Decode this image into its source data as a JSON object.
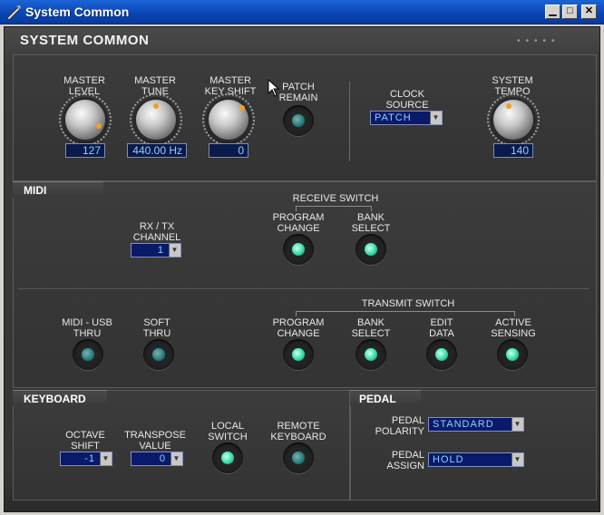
{
  "window": {
    "title": "System Common"
  },
  "header": {
    "title": "SYSTEM COMMON"
  },
  "system": {
    "master_level": {
      "label1": "MASTER",
      "label2": "LEVEL",
      "value": "127"
    },
    "master_tune": {
      "label1": "MASTER",
      "label2": "TUNE",
      "value": "440.00 Hz"
    },
    "master_key_shift": {
      "label1": "MASTER",
      "label2": "KEY SHIFT",
      "value": "0"
    },
    "patch_remain": {
      "label1": "PATCH",
      "label2": "REMAIN"
    },
    "clock_source": {
      "label1": "CLOCK",
      "label2": "SOURCE",
      "value": "PATCH"
    },
    "system_tempo": {
      "label1": "SYSTEM",
      "label2": "TEMPO",
      "value": "140"
    }
  },
  "midi": {
    "title": "MIDI",
    "rx_tx": {
      "label1": "RX / TX",
      "label2": "CHANNEL",
      "value": "1"
    },
    "receive_switch": {
      "title": "RECEIVE SWITCH",
      "program_change": {
        "label1": "PROGRAM",
        "label2": "CHANGE"
      },
      "bank_select": {
        "label1": "BANK",
        "label2": "SELECT"
      }
    },
    "midi_usb_thru": {
      "label1": "MIDI - USB",
      "label2": "THRU"
    },
    "soft_thru": {
      "label1": "SOFT",
      "label2": "THRU"
    },
    "transmit_switch": {
      "title": "TRANSMIT SWITCH",
      "program_change": {
        "label1": "PROGRAM",
        "label2": "CHANGE"
      },
      "bank_select": {
        "label1": "BANK",
        "label2": "SELECT"
      },
      "edit_data": {
        "label1": "EDIT",
        "label2": "DATA"
      },
      "active_sensing": {
        "label1": "ACTIVE",
        "label2": "SENSING"
      }
    }
  },
  "keyboard": {
    "title": "KEYBOARD",
    "octave_shift": {
      "label1": "OCTAVE",
      "label2": "SHIFT",
      "value": "-1"
    },
    "transpose": {
      "label1": "TRANSPOSE",
      "label2": "VALUE",
      "value": "0"
    },
    "local_switch": {
      "label1": "LOCAL",
      "label2": "SWITCH"
    },
    "remote_keyboard": {
      "label1": "REMOTE",
      "label2": "KEYBOARD"
    }
  },
  "pedal": {
    "title": "PEDAL",
    "polarity": {
      "label1": "PEDAL",
      "label2": "POLARITY",
      "value": "STANDARD"
    },
    "assign": {
      "label1": "PEDAL",
      "label2": "ASSIGN",
      "value": "HOLD"
    }
  },
  "icons": {
    "minimize": "minimize-icon",
    "maximize": "maximize-icon",
    "close": "close-icon"
  },
  "colors": {
    "title_bar": "#0a44b4",
    "value_bg": "#0a1a4a",
    "value_text": "#8fd0ff",
    "led_on": "#40e0b0"
  }
}
